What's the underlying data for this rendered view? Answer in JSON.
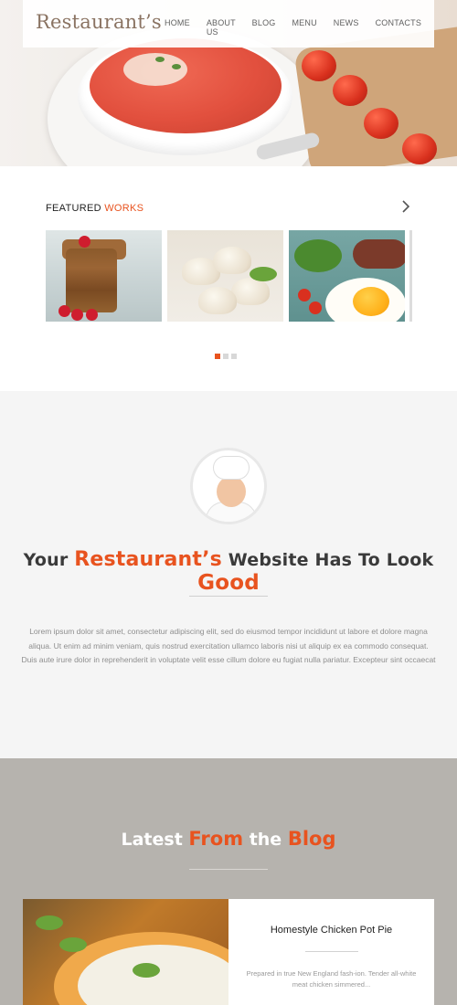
{
  "header": {
    "brand": "Restaurant’s",
    "nav": [
      "HOME",
      "ABOUT US",
      "BLOG",
      "MENU",
      "NEWS",
      "CONTACTS"
    ]
  },
  "featured": {
    "title_part1": "FEATURED",
    "title_part2": "WORKS",
    "slides": 3,
    "active_slide": 1
  },
  "about": {
    "headline_part1": "Your",
    "headline_accent1": "Restaurant’s",
    "headline_part2": "Website Has To Look",
    "headline_accent2": "Good",
    "body": "Lorem ipsum dolor sit amet, consectetur adipiscing elit, sed do eiusmod tempor incididunt ut labore et dolore magna aliqua. Ut enim ad minim veniam, quis nostrud exercitation ullamco laboris nisi ut aliquip ex ea commodo consequat. Duis aute irure dolor in reprehenderit in voluptate velit esse cillum dolore eu fugiat nulla pariatur. Excepteur sint occaecat"
  },
  "blog": {
    "title_part1": "Latest",
    "title_accent1": "From",
    "title_part2": "the",
    "title_accent2": "Blog",
    "post": {
      "title": "Homestyle Chicken Pot Pie",
      "excerpt": "Prepared in true New England fash-ion. Tender all-white meat chicken simmered..."
    }
  },
  "colors": {
    "accent": "#e8531f",
    "brand": "#8a7362",
    "blog_bg": "#b6b3ae",
    "about_bg": "#f5f5f5"
  },
  "icons": {
    "next_arrow": "chevron-right-icon"
  }
}
